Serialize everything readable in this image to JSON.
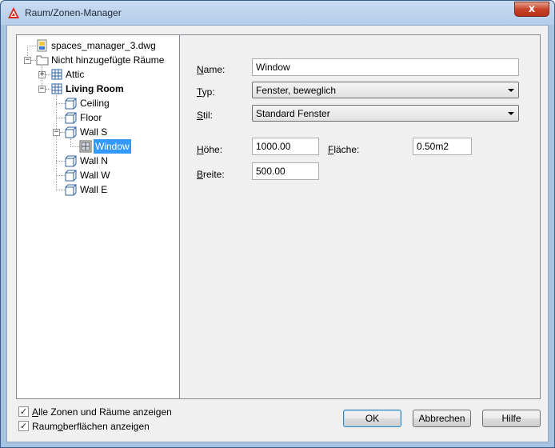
{
  "window": {
    "title": "Raum/Zonen-Manager",
    "close_glyph": "x"
  },
  "tree": {
    "items": [
      {
        "label": "spaces_manager_3.dwg",
        "icon": "dwg-file-icon"
      },
      {
        "label": "Nicht hinzugefügte Räume",
        "icon": "folder-icon",
        "expander": "−"
      },
      {
        "label": "Attic",
        "icon": "zone-icon",
        "expander": "+"
      },
      {
        "label": "Living Room",
        "icon": "zone-icon",
        "expander": "−"
      },
      {
        "label": "Ceiling",
        "icon": "surface-icon"
      },
      {
        "label": "Floor",
        "icon": "surface-icon"
      },
      {
        "label": "Wall S",
        "icon": "surface-icon",
        "expander": "−"
      },
      {
        "label": "Window",
        "icon": "window-icon"
      },
      {
        "label": "Wall N",
        "icon": "surface-icon"
      },
      {
        "label": "Wall W",
        "icon": "surface-icon"
      },
      {
        "label": "Wall E",
        "icon": "surface-icon"
      }
    ]
  },
  "props": {
    "name_label_u": "N",
    "name_label_rest": "ame:",
    "name_value": "Window",
    "typ_label_u": "T",
    "typ_label_rest": "yp:",
    "typ_value": "Fenster, beweglich",
    "stil_label_u": "S",
    "stil_label_rest": "til:",
    "stil_value": "Standard Fenster",
    "hoehe_label_u": "H",
    "hoehe_label_rest": "öhe:",
    "hoehe_value": "1000.00",
    "flaeche_label_u": "F",
    "flaeche_label_rest": "läche:",
    "flaeche_value": "0.50m2",
    "breite_label_u": "B",
    "breite_label_rest": "reite:",
    "breite_value": "500.00"
  },
  "options": {
    "show_all_u": "A",
    "show_all_rest": "lle Zonen und Räume anzeigen",
    "show_all_checked": "✓",
    "show_surfaces_pre": "Raum",
    "show_surfaces_u": "o",
    "show_surfaces_rest": "berflächen anzeigen",
    "show_surfaces_checked": "✓"
  },
  "buttons": {
    "ok": "OK",
    "cancel": "Abbrechen",
    "help": "Hilfe"
  }
}
